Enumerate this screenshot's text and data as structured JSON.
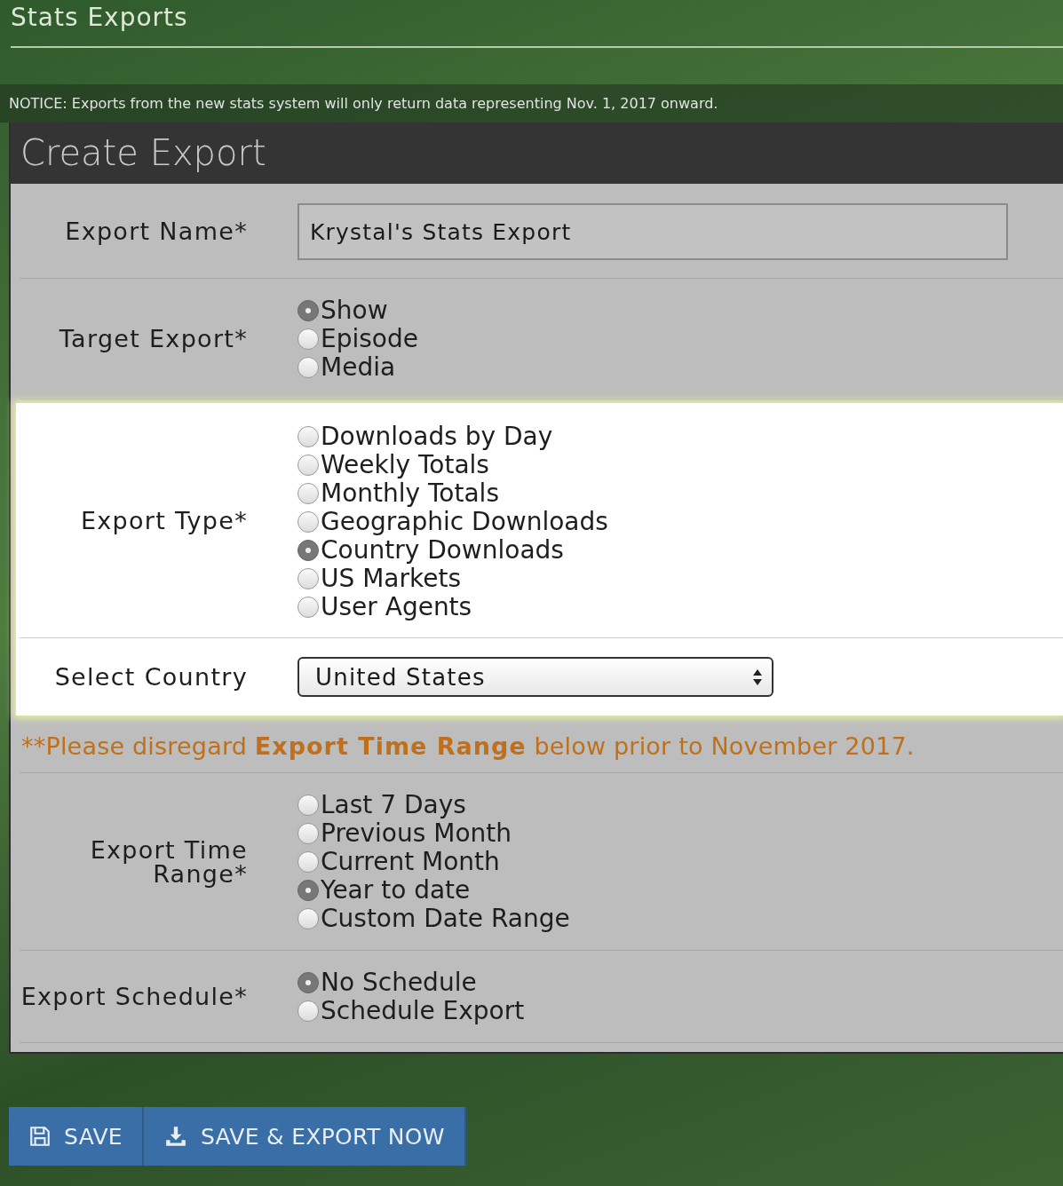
{
  "header": {
    "title": "Stats Exports"
  },
  "notice": "NOTICE: Exports from the new stats system will only return data representing Nov. 1, 2017 onward.",
  "panel": {
    "title": "Create Export"
  },
  "fields": [
    {
      "kind": "text",
      "label": "Export Name*",
      "value": "Krystal's Stats Export",
      "highlighted": false
    },
    {
      "kind": "radio",
      "label": "Target Export*",
      "highlighted": false,
      "options": [
        {
          "label": "Show",
          "selected": true
        },
        {
          "label": "Episode",
          "selected": false
        },
        {
          "label": "Media",
          "selected": false
        }
      ]
    },
    {
      "kind": "radio",
      "label": "Export Type*",
      "highlighted": true,
      "options": [
        {
          "label": "Downloads by Day",
          "selected": false
        },
        {
          "label": "Weekly Totals",
          "selected": false
        },
        {
          "label": "Monthly Totals",
          "selected": false
        },
        {
          "label": "Geographic Downloads",
          "selected": false
        },
        {
          "label": "Country Downloads",
          "selected": true
        },
        {
          "label": "US Markets",
          "selected": false
        },
        {
          "label": "User Agents",
          "selected": false
        }
      ]
    },
    {
      "kind": "select",
      "label": "Select Country",
      "value": "United States",
      "highlighted": true
    },
    {
      "kind": "note",
      "parts": [
        {
          "text": "**Please disregard ",
          "bold": false
        },
        {
          "text": "Export Time Range",
          "bold": true
        },
        {
          "text": " below prior to November 2017.",
          "bold": false
        }
      ],
      "highlighted": false
    },
    {
      "kind": "radio",
      "label": "Export Time Range*",
      "highlighted": false,
      "options": [
        {
          "label": "Last 7 Days",
          "selected": false
        },
        {
          "label": "Previous Month",
          "selected": false
        },
        {
          "label": "Current Month",
          "selected": false
        },
        {
          "label": "Year to date",
          "selected": true
        },
        {
          "label": "Custom Date Range",
          "selected": false
        }
      ]
    },
    {
      "kind": "radio",
      "label": "Export Schedule*",
      "highlighted": false,
      "options": [
        {
          "label": "No Schedule",
          "selected": true
        },
        {
          "label": "Schedule Export",
          "selected": false
        }
      ]
    }
  ],
  "buttons": [
    {
      "kind": "save",
      "label": "SAVE"
    },
    {
      "kind": "export",
      "label": "SAVE & EXPORT NOW"
    }
  ]
}
